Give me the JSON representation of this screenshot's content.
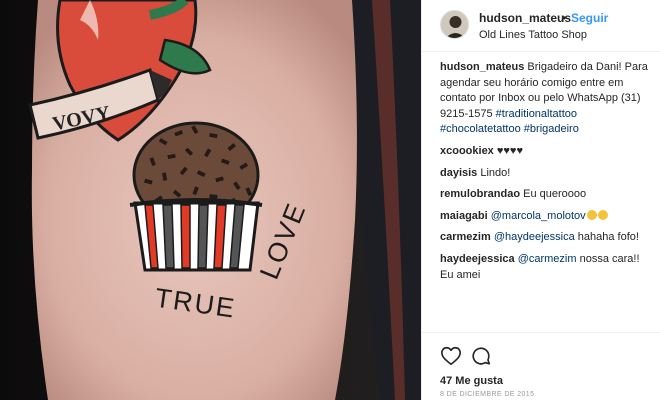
{
  "post": {
    "tattoo_text": "TRUE LOVE",
    "banner_text": "VOVY"
  },
  "header": {
    "username": "hudson_mateus",
    "separator": "•",
    "follow_label": "Seguir",
    "location": "Old Lines Tattoo Shop"
  },
  "caption": {
    "username": "hudson_mateus",
    "text": " Brigadeiro da Dani! Para agendar seu horário comigo entre em contato por Inbox ou pelo WhatsApp (31) 9215-1575",
    "hashtags": [
      "#traditionaltattoo",
      "#chocolatetattoo",
      "#brigadeiro"
    ]
  },
  "comments": [
    {
      "username": "xcoookiex",
      "text": " ♥♥♥♥"
    },
    {
      "username": "dayisis",
      "text": " Lindo!"
    },
    {
      "username": "remulobrandao",
      "text": " Eu queroooo"
    },
    {
      "username": "maiagabi",
      "mention": "@marcola_molotov",
      "text": ""
    },
    {
      "username": "carmezim",
      "mention": "@haydeejessica",
      "text": " hahaha fofo!"
    },
    {
      "username": "haydeejessica",
      "mention": "@carmezim",
      "text": " nossa cara!! Eu amei"
    }
  ],
  "actions": {
    "likes": "47 Me gusta",
    "date": "8 DE DICIEMBRE DE 2015",
    "like_icon": "heart-icon",
    "comment_icon": "comment-icon"
  },
  "colors": {
    "link": "#003569",
    "follow": "#3897f0",
    "tattoo_red": "#e23a27",
    "tattoo_ink": "#1b1b1b"
  }
}
